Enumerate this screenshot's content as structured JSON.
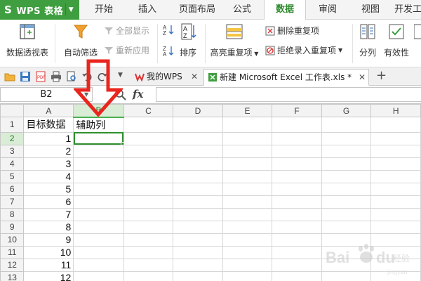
{
  "menubar": {
    "app_name": "WPS 表格",
    "tabs": [
      {
        "label": "开始"
      },
      {
        "label": "插入"
      },
      {
        "label": "页面布局"
      },
      {
        "label": "公式"
      },
      {
        "label": "数据",
        "active": true
      },
      {
        "label": "审阅"
      },
      {
        "label": "视图"
      },
      {
        "label": "开发工"
      }
    ]
  },
  "ribbon": {
    "pivot_table": "数据透视表",
    "auto_filter": "自动筛选",
    "show_all": "全部显示",
    "reapply": "重新应用",
    "sort": "排序",
    "highlight_duplicates": "高亮重复项",
    "remove_duplicates": "删除重复项",
    "reject_duplicates": "拒绝录入重复项",
    "text_to_columns": "分列",
    "validity": "有效性"
  },
  "doc_tabs": [
    {
      "label": "我的WPS",
      "icon": "wps-logo-icon"
    },
    {
      "label": "新建 Microsoft Excel 工作表.xls *",
      "icon": "spreadsheet-icon",
      "active": true
    }
  ],
  "formula_bar": {
    "name_box": "B2",
    "fx": "fx",
    "formula": ""
  },
  "sheet": {
    "columns": [
      "A",
      "B",
      "C",
      "D",
      "E",
      "F",
      "G",
      "H"
    ],
    "selected_column": "B",
    "selected_row": "2",
    "rows": [
      {
        "num": "1",
        "a": "目标数据",
        "b": "辅助列"
      },
      {
        "num": "2",
        "a": "1",
        "b": ""
      },
      {
        "num": "3",
        "a": "2",
        "b": ""
      },
      {
        "num": "4",
        "a": "3",
        "b": ""
      },
      {
        "num": "5",
        "a": "4",
        "b": ""
      },
      {
        "num": "6",
        "a": "5",
        "b": ""
      },
      {
        "num": "7",
        "a": "6",
        "b": ""
      },
      {
        "num": "8",
        "a": "7",
        "b": ""
      },
      {
        "num": "9",
        "a": "8",
        "b": ""
      },
      {
        "num": "10",
        "a": "9",
        "b": ""
      },
      {
        "num": "11",
        "a": "10",
        "b": ""
      },
      {
        "num": "12",
        "a": "11",
        "b": ""
      },
      {
        "num": "13",
        "a": "12",
        "b": ""
      }
    ]
  },
  "colors": {
    "accent_green": "#3f9e3f",
    "annotation_red": "#e8261e"
  }
}
